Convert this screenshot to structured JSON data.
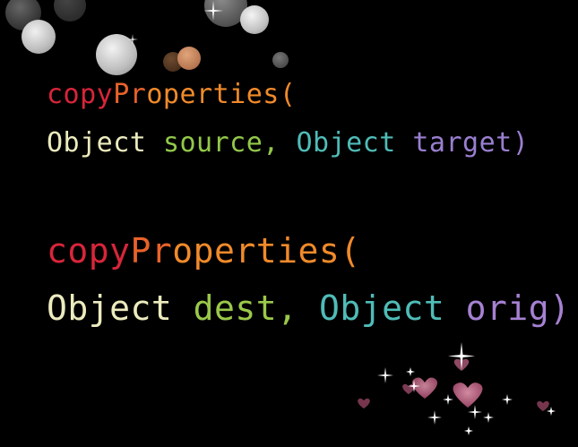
{
  "lines": [
    {
      "tokens": [
        {
          "text": "copy",
          "color": "#d8253a"
        },
        {
          "text": "Pr",
          "color": "#e8622a"
        },
        {
          "text": "operties(",
          "color": "#f08a2a"
        }
      ]
    },
    {
      "tokens": [
        {
          "text": "Object",
          "color": "#ecebbe"
        },
        {
          "text": " ",
          "color": "#ecebbe"
        },
        {
          "text": "source,",
          "color": "#92c84a"
        },
        {
          "text": " ",
          "color": "#92c84a"
        },
        {
          "text": "Object",
          "color": "#4fbcb8"
        },
        {
          "text": " ",
          "color": "#4fbcb8"
        },
        {
          "text": "target)",
          "color": "#9a7fd0"
        }
      ]
    },
    {
      "tokens": [
        {
          "text": "copy",
          "color": "#d8253a"
        },
        {
          "text": "Pr",
          "color": "#e8622a"
        },
        {
          "text": "operties(",
          "color": "#f08a2a"
        }
      ]
    },
    {
      "tokens": [
        {
          "text": "Object",
          "color": "#ecebbe"
        },
        {
          "text": " ",
          "color": "#ecebbe"
        },
        {
          "text": "dest,",
          "color": "#9ac84a"
        },
        {
          "text": " ",
          "color": "#9ac84a"
        },
        {
          "text": "Object",
          "color": "#4fbcb8"
        },
        {
          "text": " ",
          "color": "#4fbcb8"
        },
        {
          "text": "orig)",
          "color": "#a681d2"
        }
      ]
    }
  ],
  "colors": {
    "background": "#000000",
    "bokeh": "#d8d8d8",
    "bokeh_warm": "#d0906a",
    "heart": "#c9708d",
    "sparkle": "#ffffff"
  },
  "icons": [
    "bokeh-light",
    "sparkle-icon",
    "heart-icon"
  ]
}
